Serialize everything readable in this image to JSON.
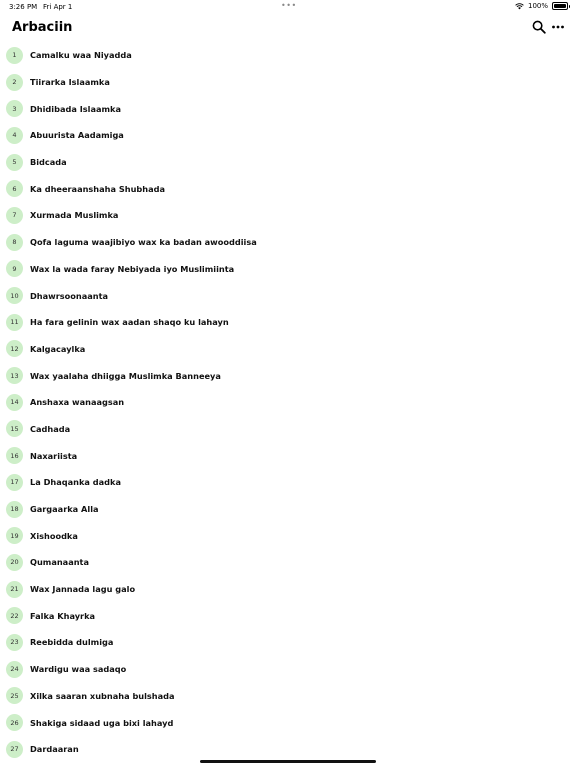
{
  "status": {
    "time": "3:26 PM",
    "date": "Fri Apr 1",
    "battery_text": "100%",
    "battery_level": 1.0
  },
  "header": {
    "title": "Arbaciin",
    "search_icon": "search-icon",
    "more_icon": "more-icon"
  },
  "colors": {
    "badge_bg": "#cdeec8",
    "text": "#111111"
  },
  "items": [
    {
      "number": "1",
      "title": "Camalku waa Niyadda"
    },
    {
      "number": "2",
      "title": "Tiirarka Islaamka"
    },
    {
      "number": "3",
      "title": "Dhidibada Islaamka"
    },
    {
      "number": "4",
      "title": "Abuurista Aadamiga"
    },
    {
      "number": "5",
      "title": "Bidcada"
    },
    {
      "number": "6",
      "title": "Ka dheeraanshaha Shubhada"
    },
    {
      "number": "7",
      "title": "Xurmada Muslimka"
    },
    {
      "number": "8",
      "title": "Qofa laguma waajibiyo wax ka badan awooddiisa"
    },
    {
      "number": "9",
      "title": "Wax la wada faray Nebiyada iyo Muslimiinta"
    },
    {
      "number": "10",
      "title": "Dhawrsoonaanta"
    },
    {
      "number": "11",
      "title": "Ha fara gelinin wax aadan shaqo ku lahayn"
    },
    {
      "number": "12",
      "title": "Kalgacaylka"
    },
    {
      "number": "13",
      "title": "Wax yaalaha dhiigga Muslimka Banneeya"
    },
    {
      "number": "14",
      "title": "Anshaxa wanaagsan"
    },
    {
      "number": "15",
      "title": "Cadhada"
    },
    {
      "number": "16",
      "title": "Naxariista"
    },
    {
      "number": "17",
      "title": "La Dhaqanka dadka"
    },
    {
      "number": "18",
      "title": "Gargaarka Alla"
    },
    {
      "number": "19",
      "title": "Xishoodka"
    },
    {
      "number": "20",
      "title": "Qumanaanta"
    },
    {
      "number": "21",
      "title": "Wax Jannada lagu galo"
    },
    {
      "number": "22",
      "title": "Falka Khayrka"
    },
    {
      "number": "23",
      "title": "Reebidda dulmiga"
    },
    {
      "number": "24",
      "title": "Wardigu waa sadaqo"
    },
    {
      "number": "25",
      "title": "Xilka saaran xubnaha bulshada"
    },
    {
      "number": "26",
      "title": "Shakiga sidaad uga bixi lahayd"
    },
    {
      "number": "27",
      "title": "Dardaaran"
    }
  ]
}
